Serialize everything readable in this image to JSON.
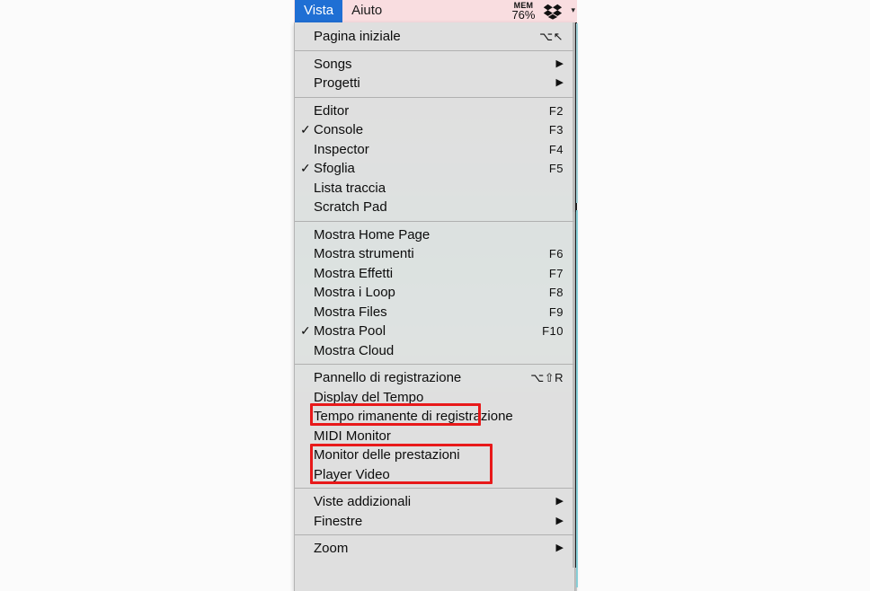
{
  "menubar": {
    "items": [
      {
        "label": "Vista",
        "active": true
      },
      {
        "label": "Aiuto",
        "active": false
      }
    ],
    "status": {
      "mem_label": "MEM",
      "mem_value": "76%",
      "dropbox_icon": "dropbox-icon",
      "overflow_chevron": "▾"
    }
  },
  "view_menu": {
    "groups": [
      {
        "items": [
          {
            "check": "",
            "label": "Pagina iniziale",
            "shortcut": "⌥↖",
            "arrow": ""
          }
        ]
      },
      {
        "items": [
          {
            "check": "",
            "label": "Songs",
            "shortcut": "",
            "arrow": "▶"
          },
          {
            "check": "",
            "label": "Progetti",
            "shortcut": "",
            "arrow": "▶"
          }
        ]
      },
      {
        "items": [
          {
            "check": "",
            "label": "Editor",
            "shortcut": "F2",
            "arrow": ""
          },
          {
            "check": "✓",
            "label": "Console",
            "shortcut": "F3",
            "arrow": ""
          },
          {
            "check": "",
            "label": "Inspector",
            "shortcut": "F4",
            "arrow": ""
          },
          {
            "check": "✓",
            "label": "Sfoglia",
            "shortcut": "F5",
            "arrow": ""
          },
          {
            "check": "",
            "label": "Lista traccia",
            "shortcut": "",
            "arrow": ""
          },
          {
            "check": "",
            "label": "Scratch Pad",
            "shortcut": "",
            "arrow": ""
          }
        ]
      },
      {
        "items": [
          {
            "check": "",
            "label": "Mostra Home Page",
            "shortcut": "",
            "arrow": ""
          },
          {
            "check": "",
            "label": "Mostra strumenti",
            "shortcut": "F6",
            "arrow": ""
          },
          {
            "check": "",
            "label": "Mostra Effetti",
            "shortcut": "F7",
            "arrow": ""
          },
          {
            "check": "",
            "label": "Mostra i Loop",
            "shortcut": "F8",
            "arrow": ""
          },
          {
            "check": "",
            "label": "Mostra Files",
            "shortcut": "F9",
            "arrow": ""
          },
          {
            "check": "✓",
            "label": "Mostra Pool",
            "shortcut": "F10",
            "arrow": ""
          },
          {
            "check": "",
            "label": "Mostra Cloud",
            "shortcut": "",
            "arrow": ""
          }
        ]
      },
      {
        "items": [
          {
            "check": "",
            "label": "Pannello di registrazione",
            "shortcut": "⌥⇧R",
            "arrow": ""
          },
          {
            "check": "",
            "label": "Display del Tempo",
            "shortcut": "",
            "arrow": ""
          },
          {
            "check": "",
            "label": "Tempo rimanente di registrazione",
            "shortcut": "",
            "arrow": ""
          },
          {
            "check": "",
            "label": "MIDI Monitor",
            "shortcut": "",
            "arrow": ""
          },
          {
            "check": "",
            "label": "Monitor delle prestazioni",
            "shortcut": "",
            "arrow": ""
          },
          {
            "check": "",
            "label": "Player Video",
            "shortcut": "",
            "arrow": ""
          }
        ]
      },
      {
        "items": [
          {
            "check": "",
            "label": "Viste addizionali",
            "shortcut": "",
            "arrow": "▶"
          },
          {
            "check": "",
            "label": "Finestre",
            "shortcut": "",
            "arrow": "▶"
          }
        ]
      },
      {
        "items": [
          {
            "check": "",
            "label": "Zoom",
            "shortcut": "",
            "arrow": "▶"
          }
        ]
      }
    ]
  },
  "annotations": {
    "highlight_color": "#e8191a",
    "boxes": [
      {
        "name": "display-del-tempo"
      },
      {
        "name": "midi-monitor-and-performance-monitor"
      }
    ]
  },
  "theme": {
    "menubar_bg": "#f9dde0",
    "active_menu_bg": "#1f6fd4",
    "menu_bg": "#e2e2e2",
    "text_color": "#0c0c0c"
  }
}
